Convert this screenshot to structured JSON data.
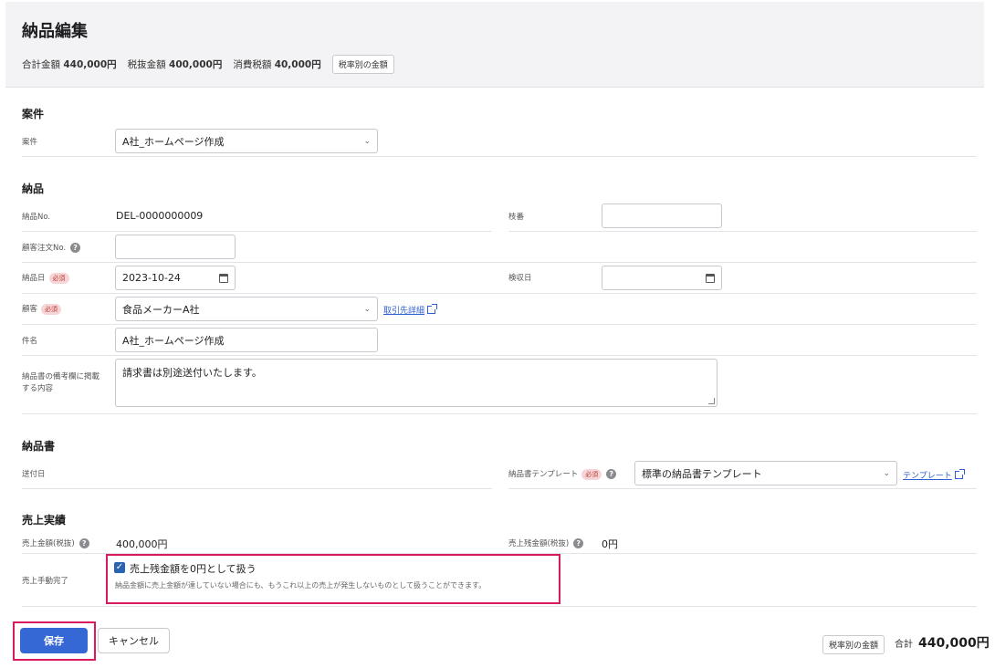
{
  "header": {
    "title": "納品編集",
    "total_label": "合計金額",
    "total_value": "440,000円",
    "pretax_label": "税抜金額",
    "pretax_value": "400,000円",
    "tax_label": "消費税額",
    "tax_value": "40,000円",
    "by_rate_button": "税率別の金額"
  },
  "project": {
    "section_title": "案件",
    "label": "案件",
    "value": "A社_ホームページ作成"
  },
  "delivery": {
    "section_title": "納品",
    "no_label": "納品No.",
    "no_value": "DEL-0000000009",
    "branch_label": "枝番",
    "branch_value": "",
    "customer_order_label": "顧客注文No.",
    "customer_order_value": "",
    "date_label": "納品日",
    "date_value": "2023-10-24",
    "inspection_label": "検収日",
    "inspection_value": "",
    "customer_label": "顧客",
    "customer_value": "食品メーカーA社",
    "customer_link": "取引先詳細",
    "subject_label": "件名",
    "subject_value": "A社_ホームページ作成",
    "notes_label_1": "納品書の備考欄に掲載",
    "notes_label_2": "する内容",
    "notes_value": "請求書は別途送付いたします。",
    "required_badge": "必須"
  },
  "document": {
    "section_title": "納品書",
    "sent_label": "送付日",
    "template_label": "納品書テンプレート",
    "template_value": "標準の納品書テンプレート",
    "template_link": "テンプレート"
  },
  "sales": {
    "section_title": "売上実績",
    "amount_label": "売上金額(税抜)",
    "amount_value": "400,000円",
    "remaining_label": "売上残金額(税抜)",
    "remaining_value": "0円",
    "manual_label": "売上手動完了",
    "checkbox_label": "売上残金額を0円として扱う",
    "checkbox_checked": true,
    "checkbox_help": "納品金額に売上金額が達していない場合にも、もうこれ以上の売上が発生しないものとして扱うことができます。"
  },
  "footer": {
    "save": "保存",
    "cancel": "キャンセル",
    "by_rate_button": "税率別の金額",
    "total_label": "合計",
    "total_value": "440,000円"
  }
}
